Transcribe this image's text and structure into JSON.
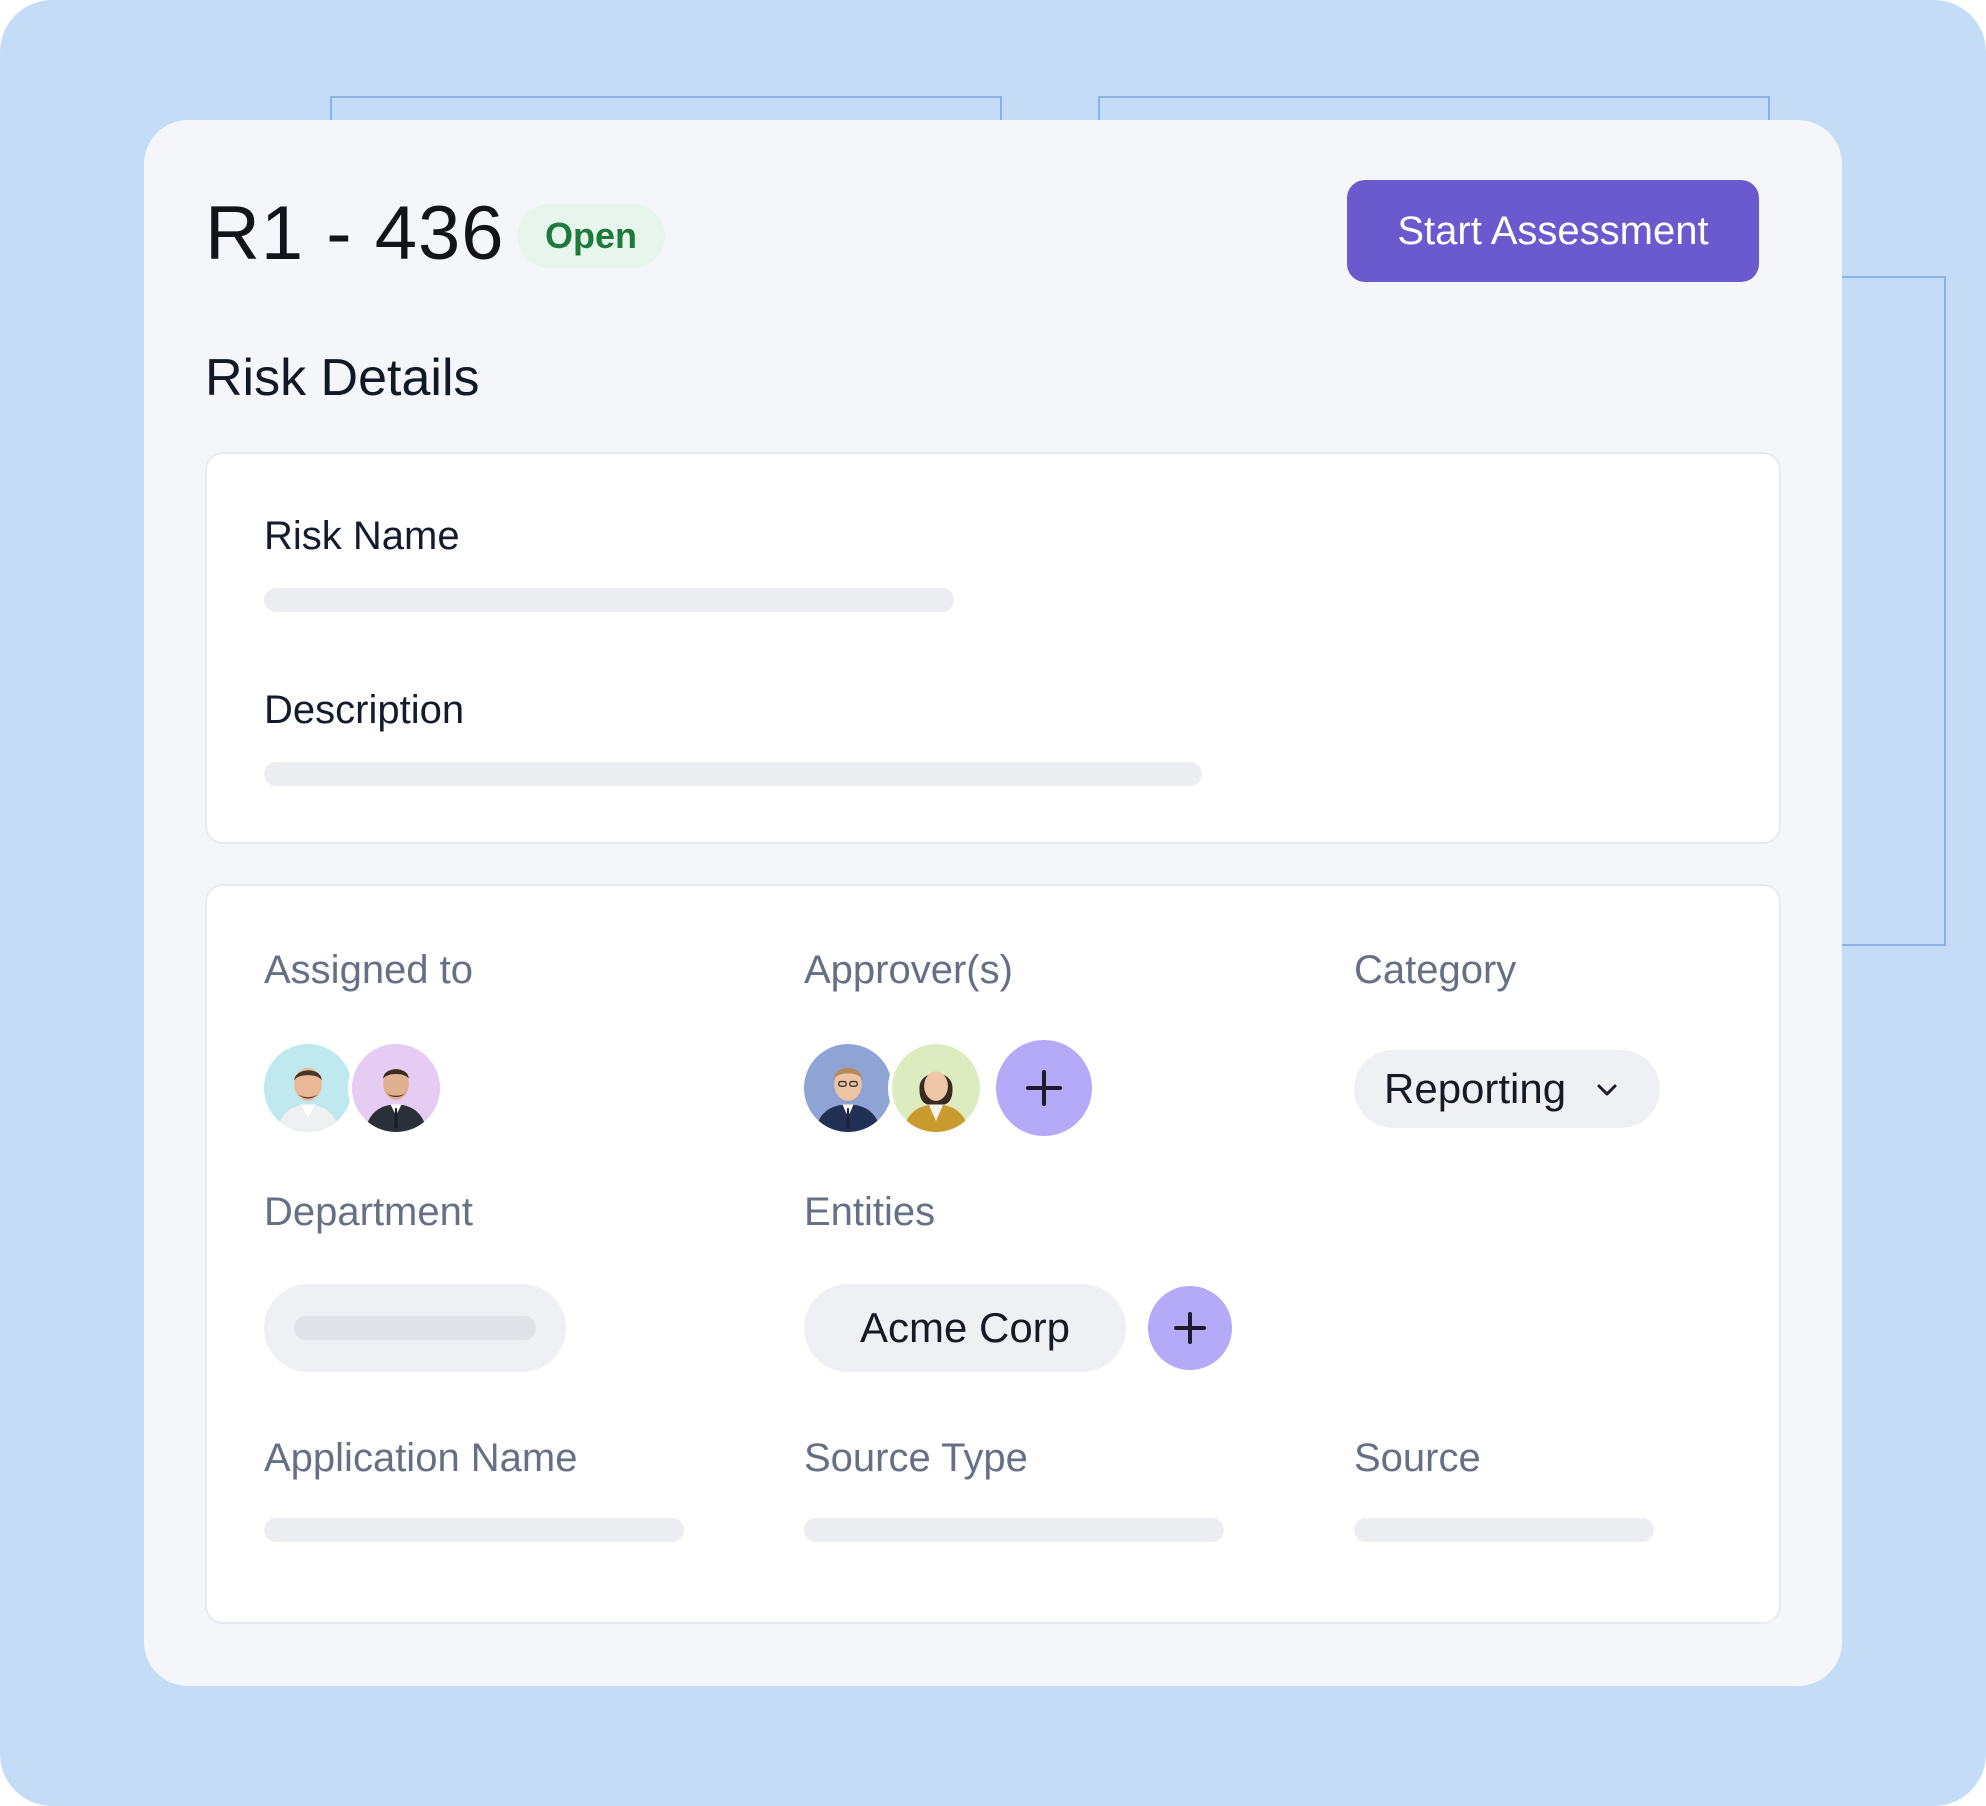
{
  "header": {
    "risk_id": "R1 - 436",
    "status": "Open",
    "action_button": "Start Assessment"
  },
  "section_title": "Risk Details",
  "overview": {
    "risk_name_label": "Risk Name",
    "description_label": "Description"
  },
  "fields": {
    "assigned_to": {
      "label": "Assigned to",
      "avatars": [
        "man-avatar",
        "man-avatar"
      ]
    },
    "approvers": {
      "label": "Approver(s)",
      "avatars": [
        "man-avatar",
        "woman-avatar"
      ],
      "add_icon": "plus-icon"
    },
    "category": {
      "label": "Category",
      "value": "Reporting",
      "icon": "chevron-down-icon"
    },
    "department": {
      "label": "Department"
    },
    "entities": {
      "label": "Entities",
      "chips": [
        "Acme Corp"
      ],
      "add_icon": "plus-icon"
    },
    "application_name": {
      "label": "Application Name"
    },
    "source_type": {
      "label": "Source Type"
    },
    "source": {
      "label": "Source"
    }
  },
  "colors": {
    "background": "#c5dcf6",
    "card": "#f4f6fa",
    "accent": "#6a5acd",
    "status_bg": "#e8f5ec",
    "status_text": "#1d7a3c",
    "add_button": "#b4aaf8"
  }
}
